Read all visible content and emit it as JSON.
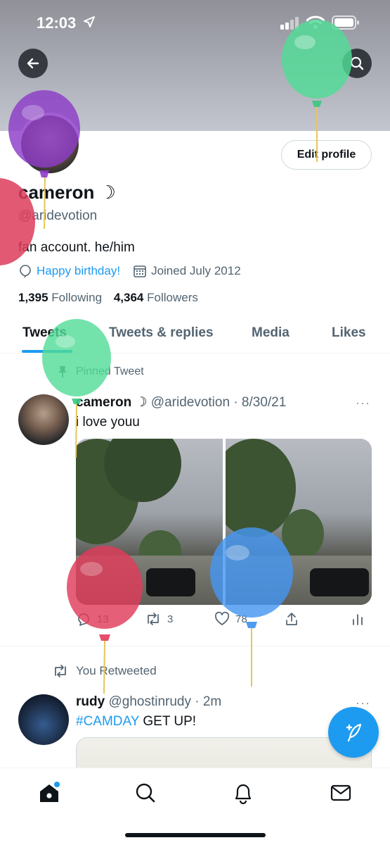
{
  "status_bar": {
    "time": "12:03"
  },
  "header": {
    "back_label": "Back",
    "search_label": "Search"
  },
  "profile": {
    "edit_button": "Edit profile",
    "display_name": "cameron ☽",
    "handle": "@aridevotion",
    "bio": "fan account. he/him",
    "birthday": "Happy birthday!",
    "joined": "Joined July 2012",
    "following_count": "1,395",
    "following_label": "Following",
    "followers_count": "4,364",
    "followers_label": "Followers"
  },
  "tabs": [
    {
      "label": "Tweets"
    },
    {
      "label": "Tweets & replies"
    },
    {
      "label": "Media"
    },
    {
      "label": "Likes"
    }
  ],
  "pinned_label": "Pinned Tweet",
  "tweets": [
    {
      "name": "cameron ☽",
      "handle_time": "@aridevotion · 8/30/21",
      "text": "i love youu",
      "replies": "13",
      "retweets": "3",
      "likes": "78",
      "more": "···"
    },
    {
      "context": "You Retweeted",
      "name": "rudy",
      "handle_time": "@ghostinrudy · 2m",
      "hashtag": "#CAMDAY",
      "text": " GET UP!",
      "more": "···"
    }
  ],
  "colors": {
    "accent": "#1d9bf0",
    "text": "#0f1419",
    "muted": "#536471"
  }
}
